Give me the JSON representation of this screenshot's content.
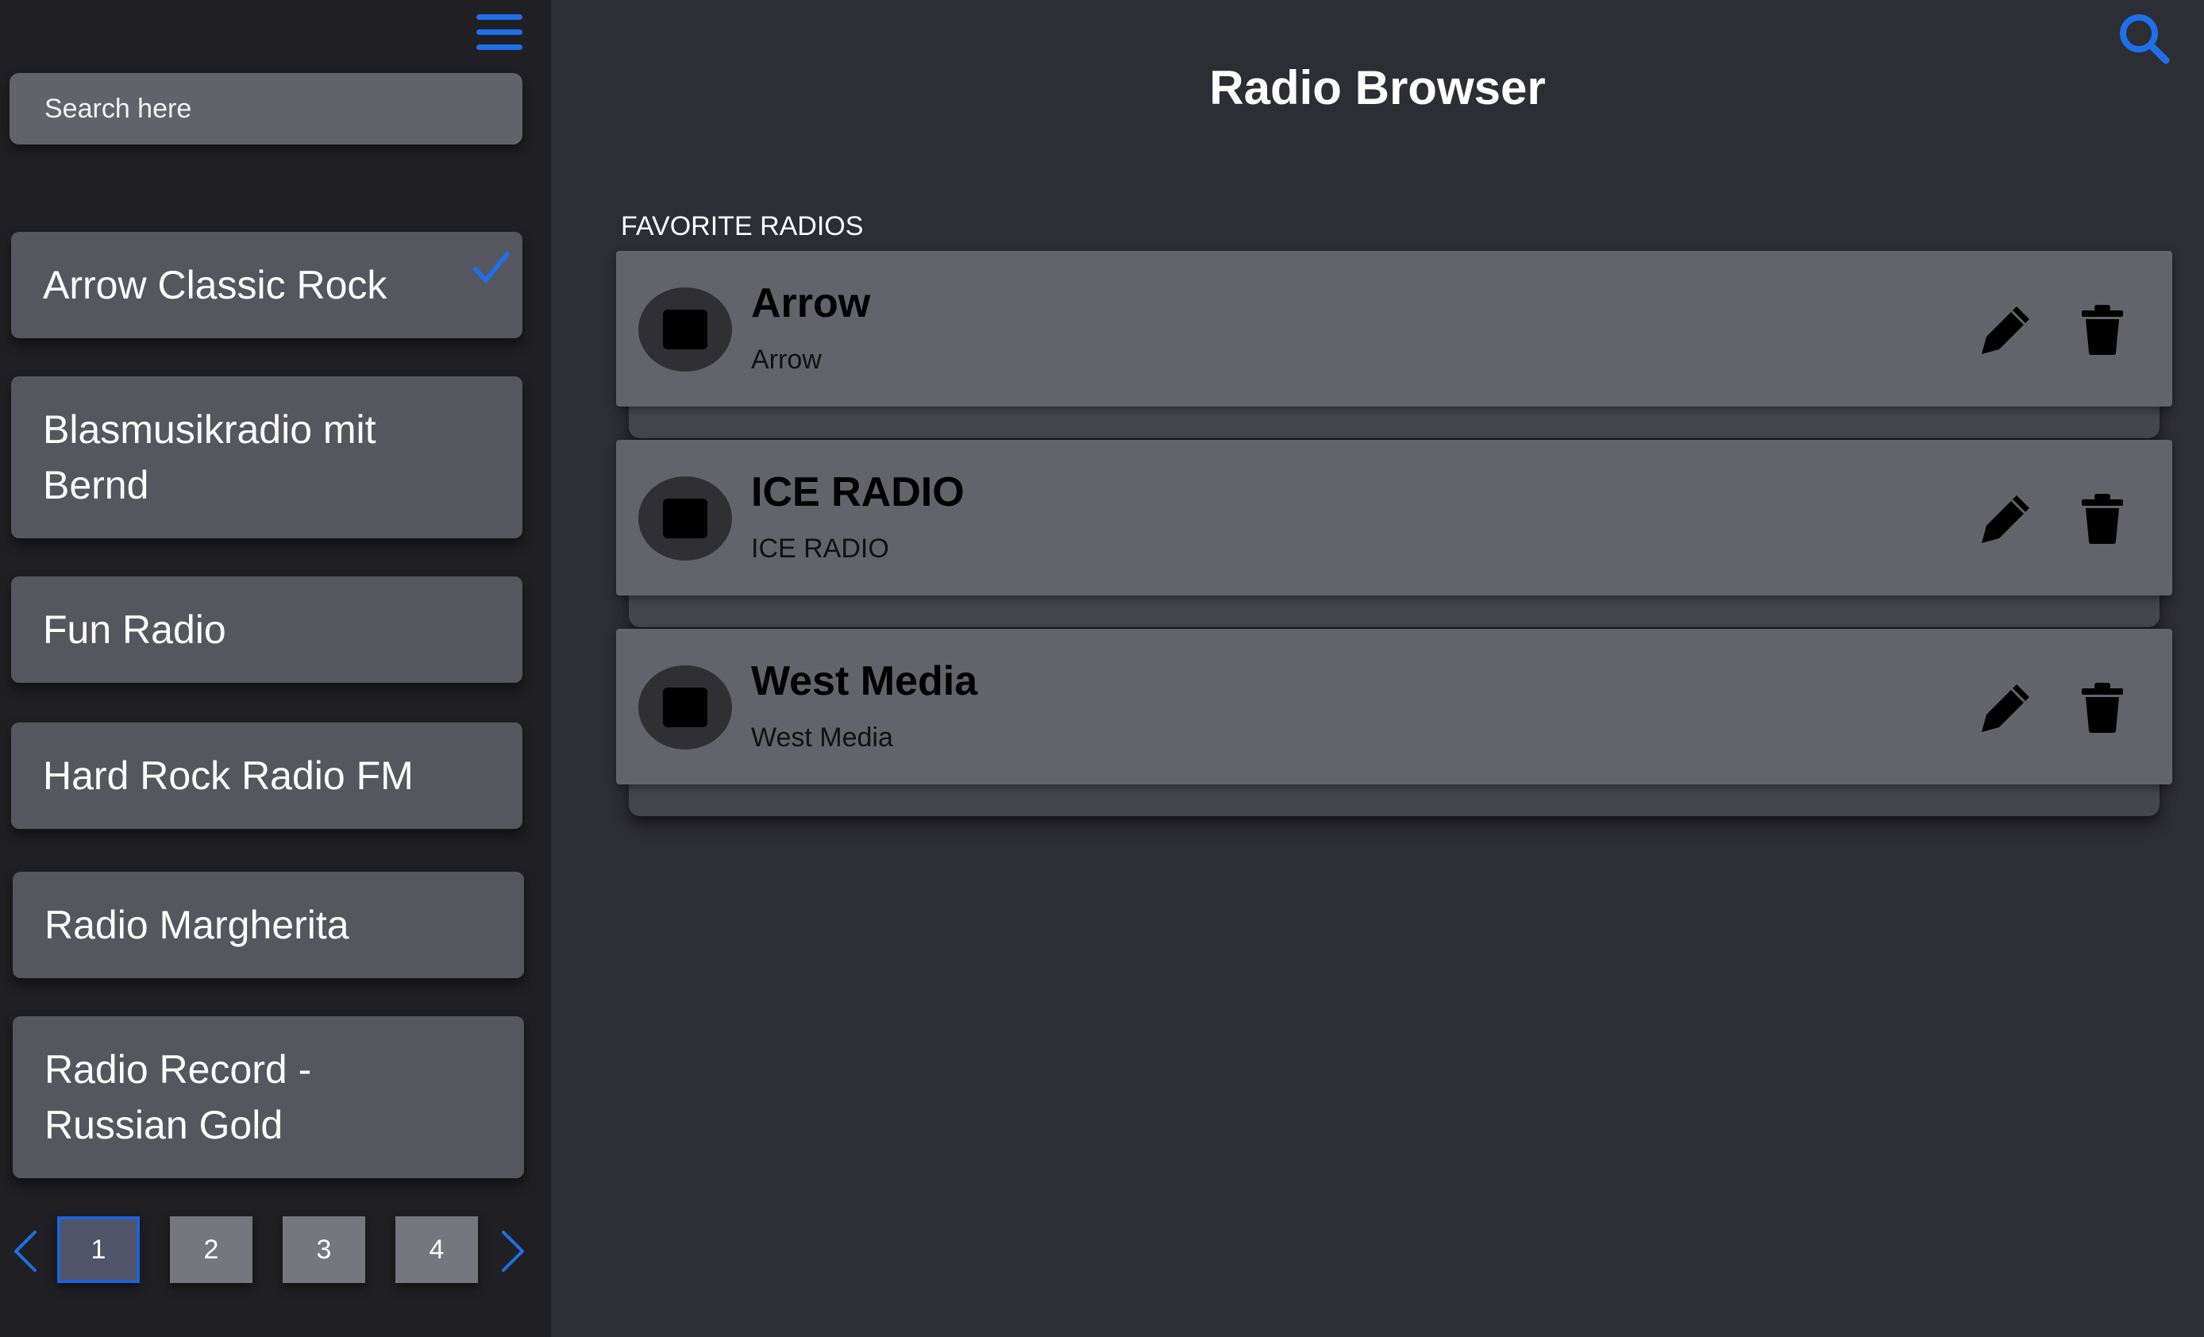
{
  "sidebar": {
    "search_placeholder": "Search here",
    "stations": [
      {
        "label": "Arrow Classic Rock",
        "selected": true
      },
      {
        "label": "Blasmusikradio mit Bernd",
        "selected": false
      },
      {
        "label": "Fun Radio",
        "selected": false
      },
      {
        "label": "Hard Rock Radio FM",
        "selected": false
      },
      {
        "label": "Radio Margherita",
        "selected": false
      },
      {
        "label": "Radio Record - Russian Gold",
        "selected": false
      }
    ],
    "pagination": {
      "pages": [
        "1",
        "2",
        "3",
        "4"
      ],
      "current": "1"
    }
  },
  "header": {
    "title": "Radio Browser"
  },
  "favorites": {
    "section_label": "FAVORITE RADIOS",
    "items": [
      {
        "name": "Arrow",
        "subtitle": "Arrow"
      },
      {
        "name": "ICE RADIO",
        "subtitle": "ICE RADIO"
      },
      {
        "name": "West Media",
        "subtitle": "West Media"
      }
    ]
  },
  "icons": {
    "menu": "hamburger-menu-icon",
    "search": "search-icon",
    "check": "checkmark-icon",
    "edit": "pencil-icon",
    "delete": "trash-icon",
    "prev": "chevron-left-icon",
    "next": "chevron-right-icon"
  },
  "colors": {
    "accent": "#1e6fe8",
    "background": "#2d2d34",
    "sidebar": "#202024",
    "card": "#63636c"
  }
}
